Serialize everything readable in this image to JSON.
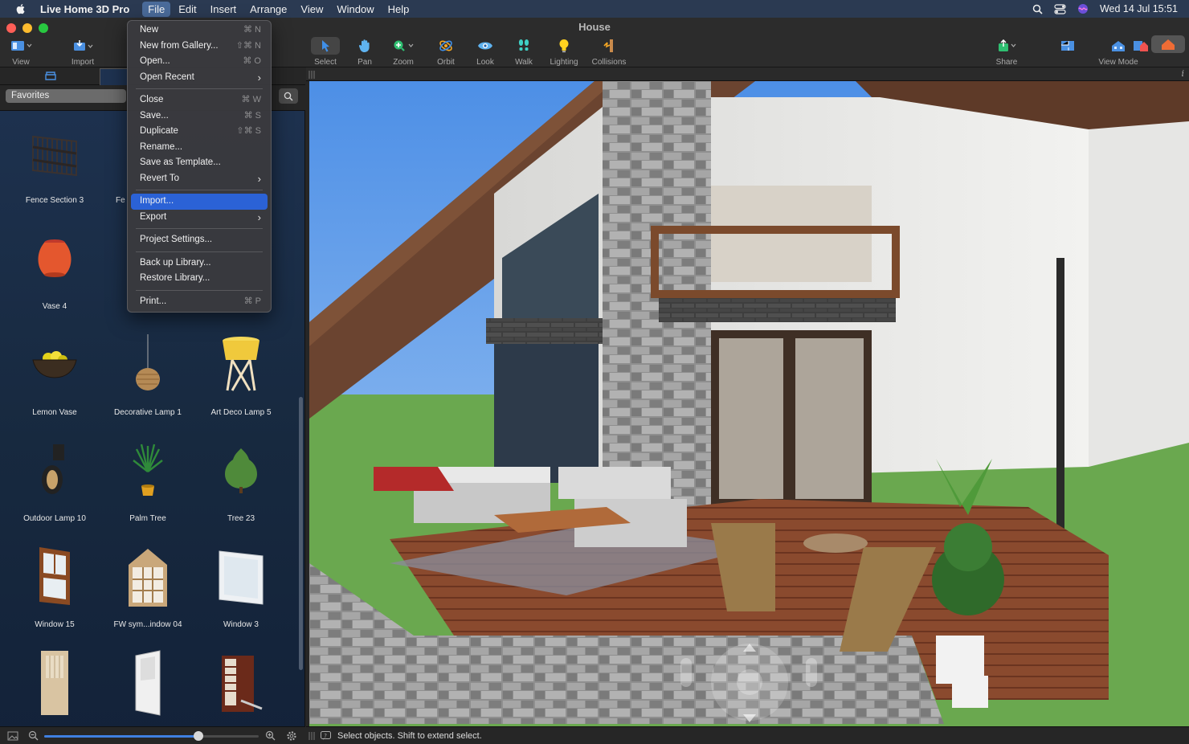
{
  "menubar": {
    "app_name": "Live Home 3D Pro",
    "items": [
      "File",
      "Edit",
      "Insert",
      "Arrange",
      "View",
      "Window",
      "Help"
    ],
    "active_item": "File",
    "clock": "Wed 14 Jul  15:51"
  },
  "window": {
    "title": "House"
  },
  "toolbar": {
    "view_label": "View",
    "import_label": "Import",
    "tools": [
      "Select",
      "Pan",
      "Zoom",
      "Orbit",
      "Look",
      "Walk",
      "Lighting",
      "Collisions"
    ],
    "share_label": "Share",
    "view_mode_label": "View Mode"
  },
  "sidebar": {
    "category": "Favorites",
    "items": [
      {
        "name": "Fence Section 3",
        "icon": "fence-icon"
      },
      {
        "name": "Fe",
        "icon": "fence-icon"
      },
      {
        "name": "",
        "icon": ""
      },
      {
        "name": "Vase 4",
        "icon": "vase-icon"
      },
      {
        "name": "",
        "icon": ""
      },
      {
        "name": "",
        "icon": ""
      },
      {
        "name": "Lemon Vase",
        "icon": "bowl-icon"
      },
      {
        "name": "Decorative Lamp 1",
        "icon": "pendant-lamp-icon"
      },
      {
        "name": "Art Deco Lamp 5",
        "icon": "floor-lamp-icon"
      },
      {
        "name": "Outdoor Lamp 10",
        "icon": "outdoor-lamp-icon"
      },
      {
        "name": "Palm Tree",
        "icon": "palm-tree-icon"
      },
      {
        "name": "Tree 23",
        "icon": "tree-icon"
      },
      {
        "name": "Window 15",
        "icon": "window-icon"
      },
      {
        "name": "FW sym...indow 04",
        "icon": "arched-window-icon"
      },
      {
        "name": "Window 3",
        "icon": "window-icon"
      },
      {
        "name": "",
        "icon": "door-icon"
      },
      {
        "name": "",
        "icon": "door-icon"
      },
      {
        "name": "",
        "icon": "door-icon"
      }
    ],
    "zoom_slider_value": 0.72
  },
  "file_menu": {
    "groups": [
      [
        {
          "label": "New",
          "shortcut": "⌘ N"
        },
        {
          "label": "New from Gallery...",
          "shortcut": "⇧⌘ N"
        },
        {
          "label": "Open...",
          "shortcut": "⌘ O"
        },
        {
          "label": "Open Recent",
          "submenu": true
        }
      ],
      [
        {
          "label": "Close",
          "shortcut": "⌘ W"
        },
        {
          "label": "Save...",
          "shortcut": "⌘ S"
        },
        {
          "label": "Duplicate",
          "shortcut": "⇧⌘ S"
        },
        {
          "label": "Rename..."
        },
        {
          "label": "Save as Template..."
        },
        {
          "label": "Revert To",
          "submenu": true
        }
      ],
      [
        {
          "label": "Import...",
          "highlighted": true
        },
        {
          "label": "Export",
          "submenu": true
        }
      ],
      [
        {
          "label": "Project Settings..."
        }
      ],
      [
        {
          "label": "Back up Library..."
        },
        {
          "label": "Restore Library..."
        }
      ],
      [
        {
          "label": "Print...",
          "shortcut": "⌘ P"
        }
      ]
    ]
  },
  "statusbar": {
    "text": "Select objects. Shift to extend select."
  },
  "colors": {
    "menu_highlight": "#2b62d6",
    "sidebar_bg": "#1e3250",
    "accent": "#3f7fe0"
  }
}
